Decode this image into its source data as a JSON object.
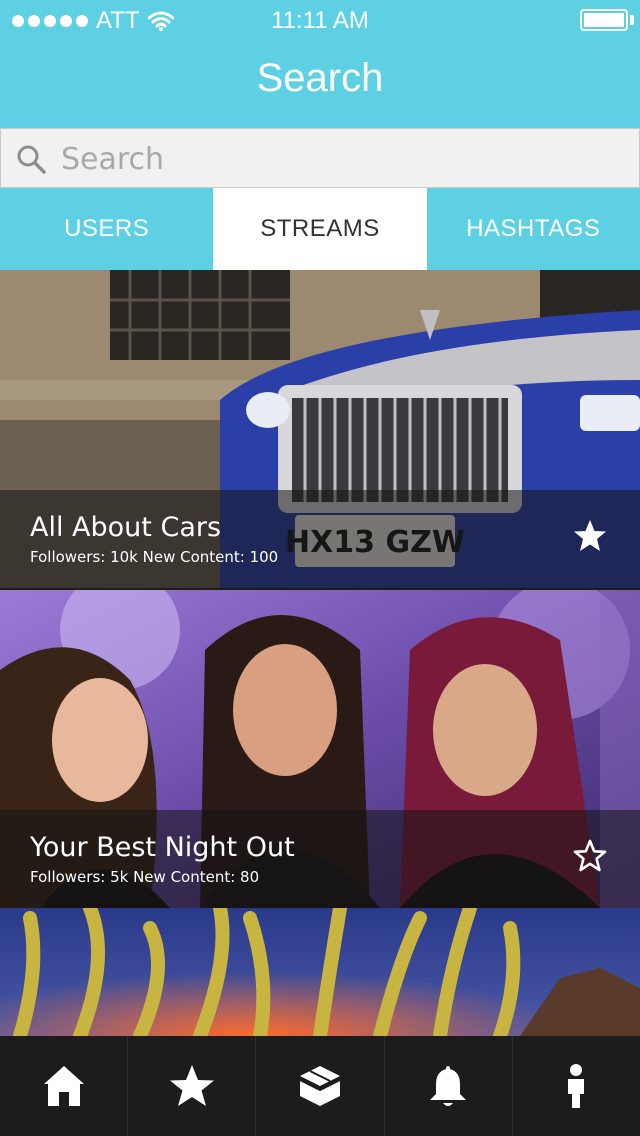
{
  "status_bar": {
    "carrier": "ATT",
    "time": "11:11 AM"
  },
  "header": {
    "title": "Search"
  },
  "search": {
    "placeholder": "Search",
    "value": ""
  },
  "tabs": [
    {
      "label": "USERS",
      "active": false
    },
    {
      "label": "STREAMS",
      "active": true
    },
    {
      "label": "HASHTAGS",
      "active": false
    }
  ],
  "streams": [
    {
      "title": "All About Cars",
      "meta": "Followers: 10k New Content: 100",
      "starred": true
    },
    {
      "title": "Your Best Night Out",
      "meta": "Followers: 5k New Content: 80",
      "starred": false
    },
    {
      "title": "",
      "meta": "",
      "starred": false
    }
  ],
  "tabbar": [
    {
      "icon": "home-icon"
    },
    {
      "icon": "star-icon"
    },
    {
      "icon": "box-icon"
    },
    {
      "icon": "bell-icon"
    },
    {
      "icon": "profile-icon"
    }
  ],
  "colors": {
    "accent": "#5dd0e3",
    "tabbar_bg": "#1c1c1c",
    "search_bg": "#f1f1f1"
  }
}
